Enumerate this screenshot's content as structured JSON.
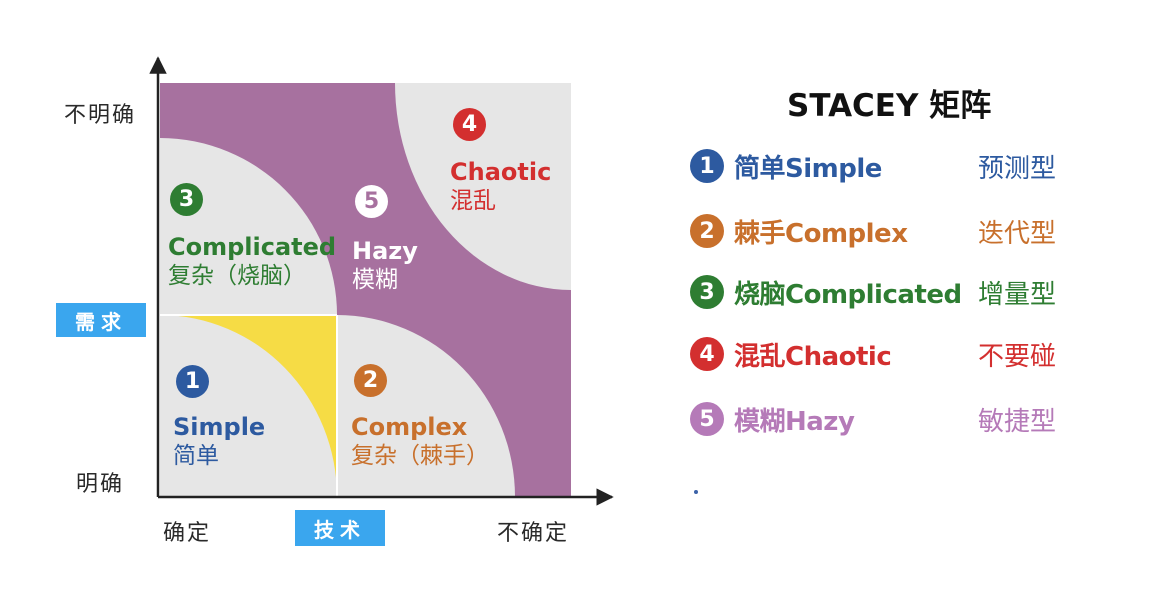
{
  "diagram": {
    "y_axis": {
      "label": "需求",
      "ticks": {
        "top": "不明确",
        "bottom": "明确"
      }
    },
    "x_axis": {
      "label": "技术",
      "ticks": {
        "left": "确定",
        "right": "不确定"
      }
    },
    "zones": [
      {
        "num": "1",
        "en": "Simple",
        "zh": "简单",
        "color": "#2d5aa0"
      },
      {
        "num": "2",
        "en": "Complex",
        "zh": "复杂（棘手）",
        "color": "#c8702c"
      },
      {
        "num": "3",
        "en": "Complicated",
        "zh": "复杂（烧脑）",
        "color": "#2e7d32"
      },
      {
        "num": "4",
        "en": "Chaotic",
        "zh": "混乱",
        "color": "#d32f2f"
      },
      {
        "num": "5",
        "en": "Hazy",
        "zh": "模糊",
        "color": "#ffffff"
      }
    ],
    "colors": {
      "purple": "#a7719f",
      "gray": "#e6e6e6",
      "yellow": "#f6dc45",
      "axis": "#222222"
    }
  },
  "legend": {
    "title": "STACEY 矩阵",
    "items": [
      {
        "num": "1",
        "name": "简单Simple",
        "approach": "预测型",
        "color": "#2d5aa0"
      },
      {
        "num": "2",
        "name": "棘手Complex",
        "approach": "迭代型",
        "color": "#c8702c"
      },
      {
        "num": "3",
        "name": "烧脑Complicated",
        "approach": "增量型",
        "color": "#2e7d32"
      },
      {
        "num": "4",
        "name": "混乱Chaotic",
        "approach": "不要碰",
        "color": "#d32f2f"
      },
      {
        "num": "5",
        "name": "模糊Hazy",
        "approach": "敏捷型",
        "color": "#b57ab8"
      }
    ]
  }
}
